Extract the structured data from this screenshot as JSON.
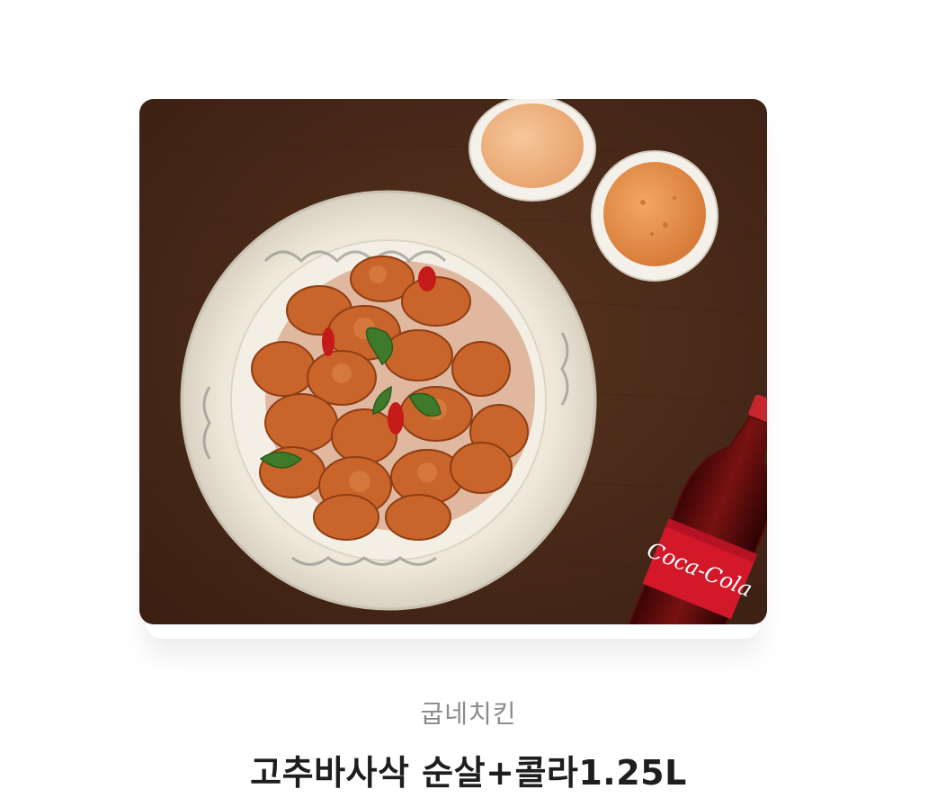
{
  "product": {
    "image_alt": "chicken-with-cola-product-image",
    "bottle_text": "Coca-Cola",
    "brand": "굽네치킨",
    "name": "고추바사삭 순살+콜라1.25L"
  },
  "colors": {
    "brand_text": "#8a8a8a",
    "title_text": "#1e1e1e",
    "table_wood": "#4a2a19"
  }
}
